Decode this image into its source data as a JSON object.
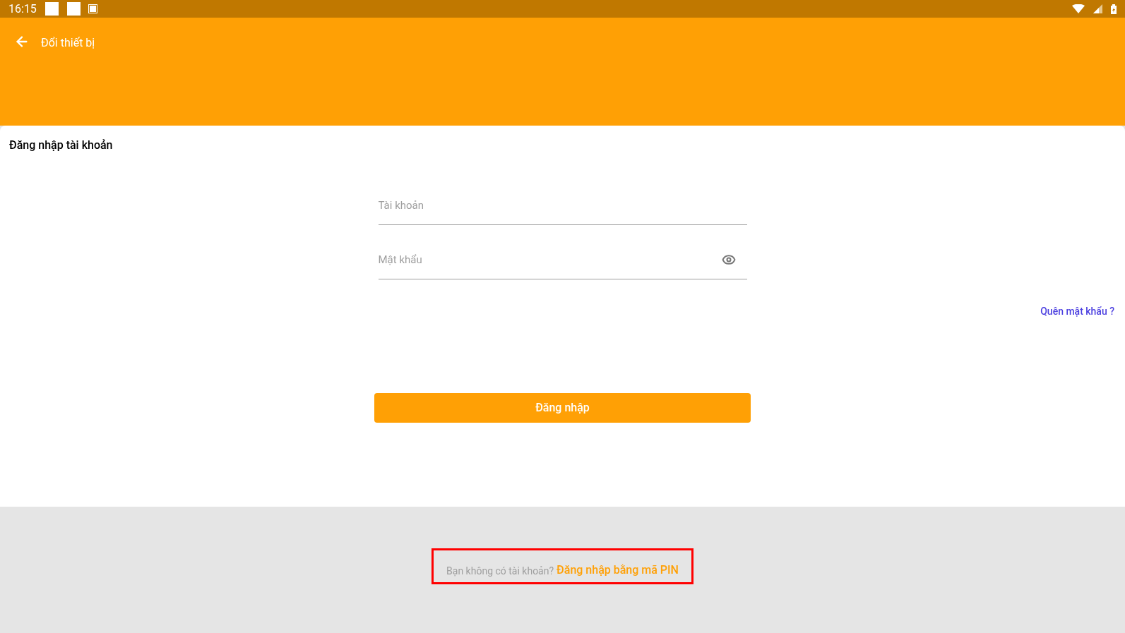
{
  "status_bar": {
    "time": "16:15"
  },
  "app_bar": {
    "title": "Đổi thiết bị"
  },
  "login_card": {
    "title": "Đăng nhập tài khoản",
    "fields": [
      {
        "kind": "text",
        "placeholder": "Tài khoản"
      },
      {
        "kind": "password",
        "placeholder": "Mật khẩu"
      }
    ],
    "forgot_link": "Quên mật khẩu ?",
    "submit_button": "Đăng nhập"
  },
  "footer": {
    "text": "Bạn không có tài khoản?",
    "link": "Đăng nhập bằng mã PIN",
    "highlighted": true
  }
}
